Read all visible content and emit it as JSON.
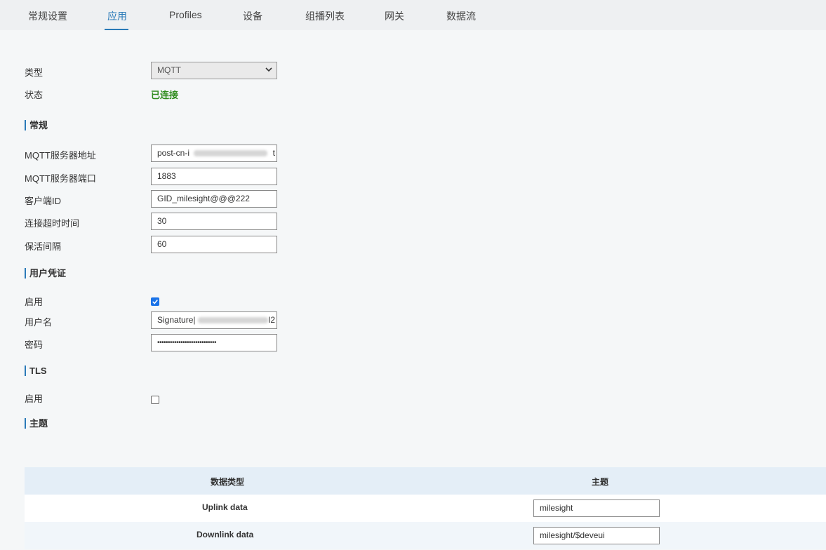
{
  "tabs": [
    {
      "label": "常规设置"
    },
    {
      "label": "应用"
    },
    {
      "label": "Profiles"
    },
    {
      "label": "设备"
    },
    {
      "label": "组播列表"
    },
    {
      "label": "网关"
    },
    {
      "label": "数据流"
    }
  ],
  "active_tab": "应用",
  "form": {
    "type_label": "类型",
    "type_value": "MQTT",
    "status_label": "状态",
    "status_value": "已连接",
    "general_section": "常规",
    "server_label": "MQTT服务器地址",
    "server_value": "post-cn-i",
    "server_value_tail": "t",
    "port_label": "MQTT服务器端口",
    "port_value": "1883",
    "client_label": "客户端ID",
    "client_value": "GID_milesight@@@222",
    "timeout_label": "连接超时时间",
    "timeout_value": "30",
    "keepalive_label": "保活间隔",
    "keepalive_value": "60",
    "cred_section": "用户凭证",
    "cred_enable_label": "启用",
    "cred_enabled": true,
    "username_label": "用户名",
    "username_value": "Signature|",
    "username_value_tail": "l2",
    "password_label": "密码",
    "password_value": "••••••••••••••••••••••••••••",
    "tls_section": "TLS",
    "tls_enable_label": "启用",
    "tls_enabled": false,
    "topic_section": "主题"
  },
  "topic_table": {
    "headers": [
      "数据类型",
      "主题"
    ],
    "rows": [
      {
        "type": "Uplink data",
        "topic": "milesight"
      },
      {
        "type": "Downlink data",
        "topic": "milesight/$deveui"
      }
    ]
  },
  "colors": {
    "accent": "#2a7ab8",
    "connected": "#2e8b1c",
    "checkbox": "#1a73e8"
  }
}
